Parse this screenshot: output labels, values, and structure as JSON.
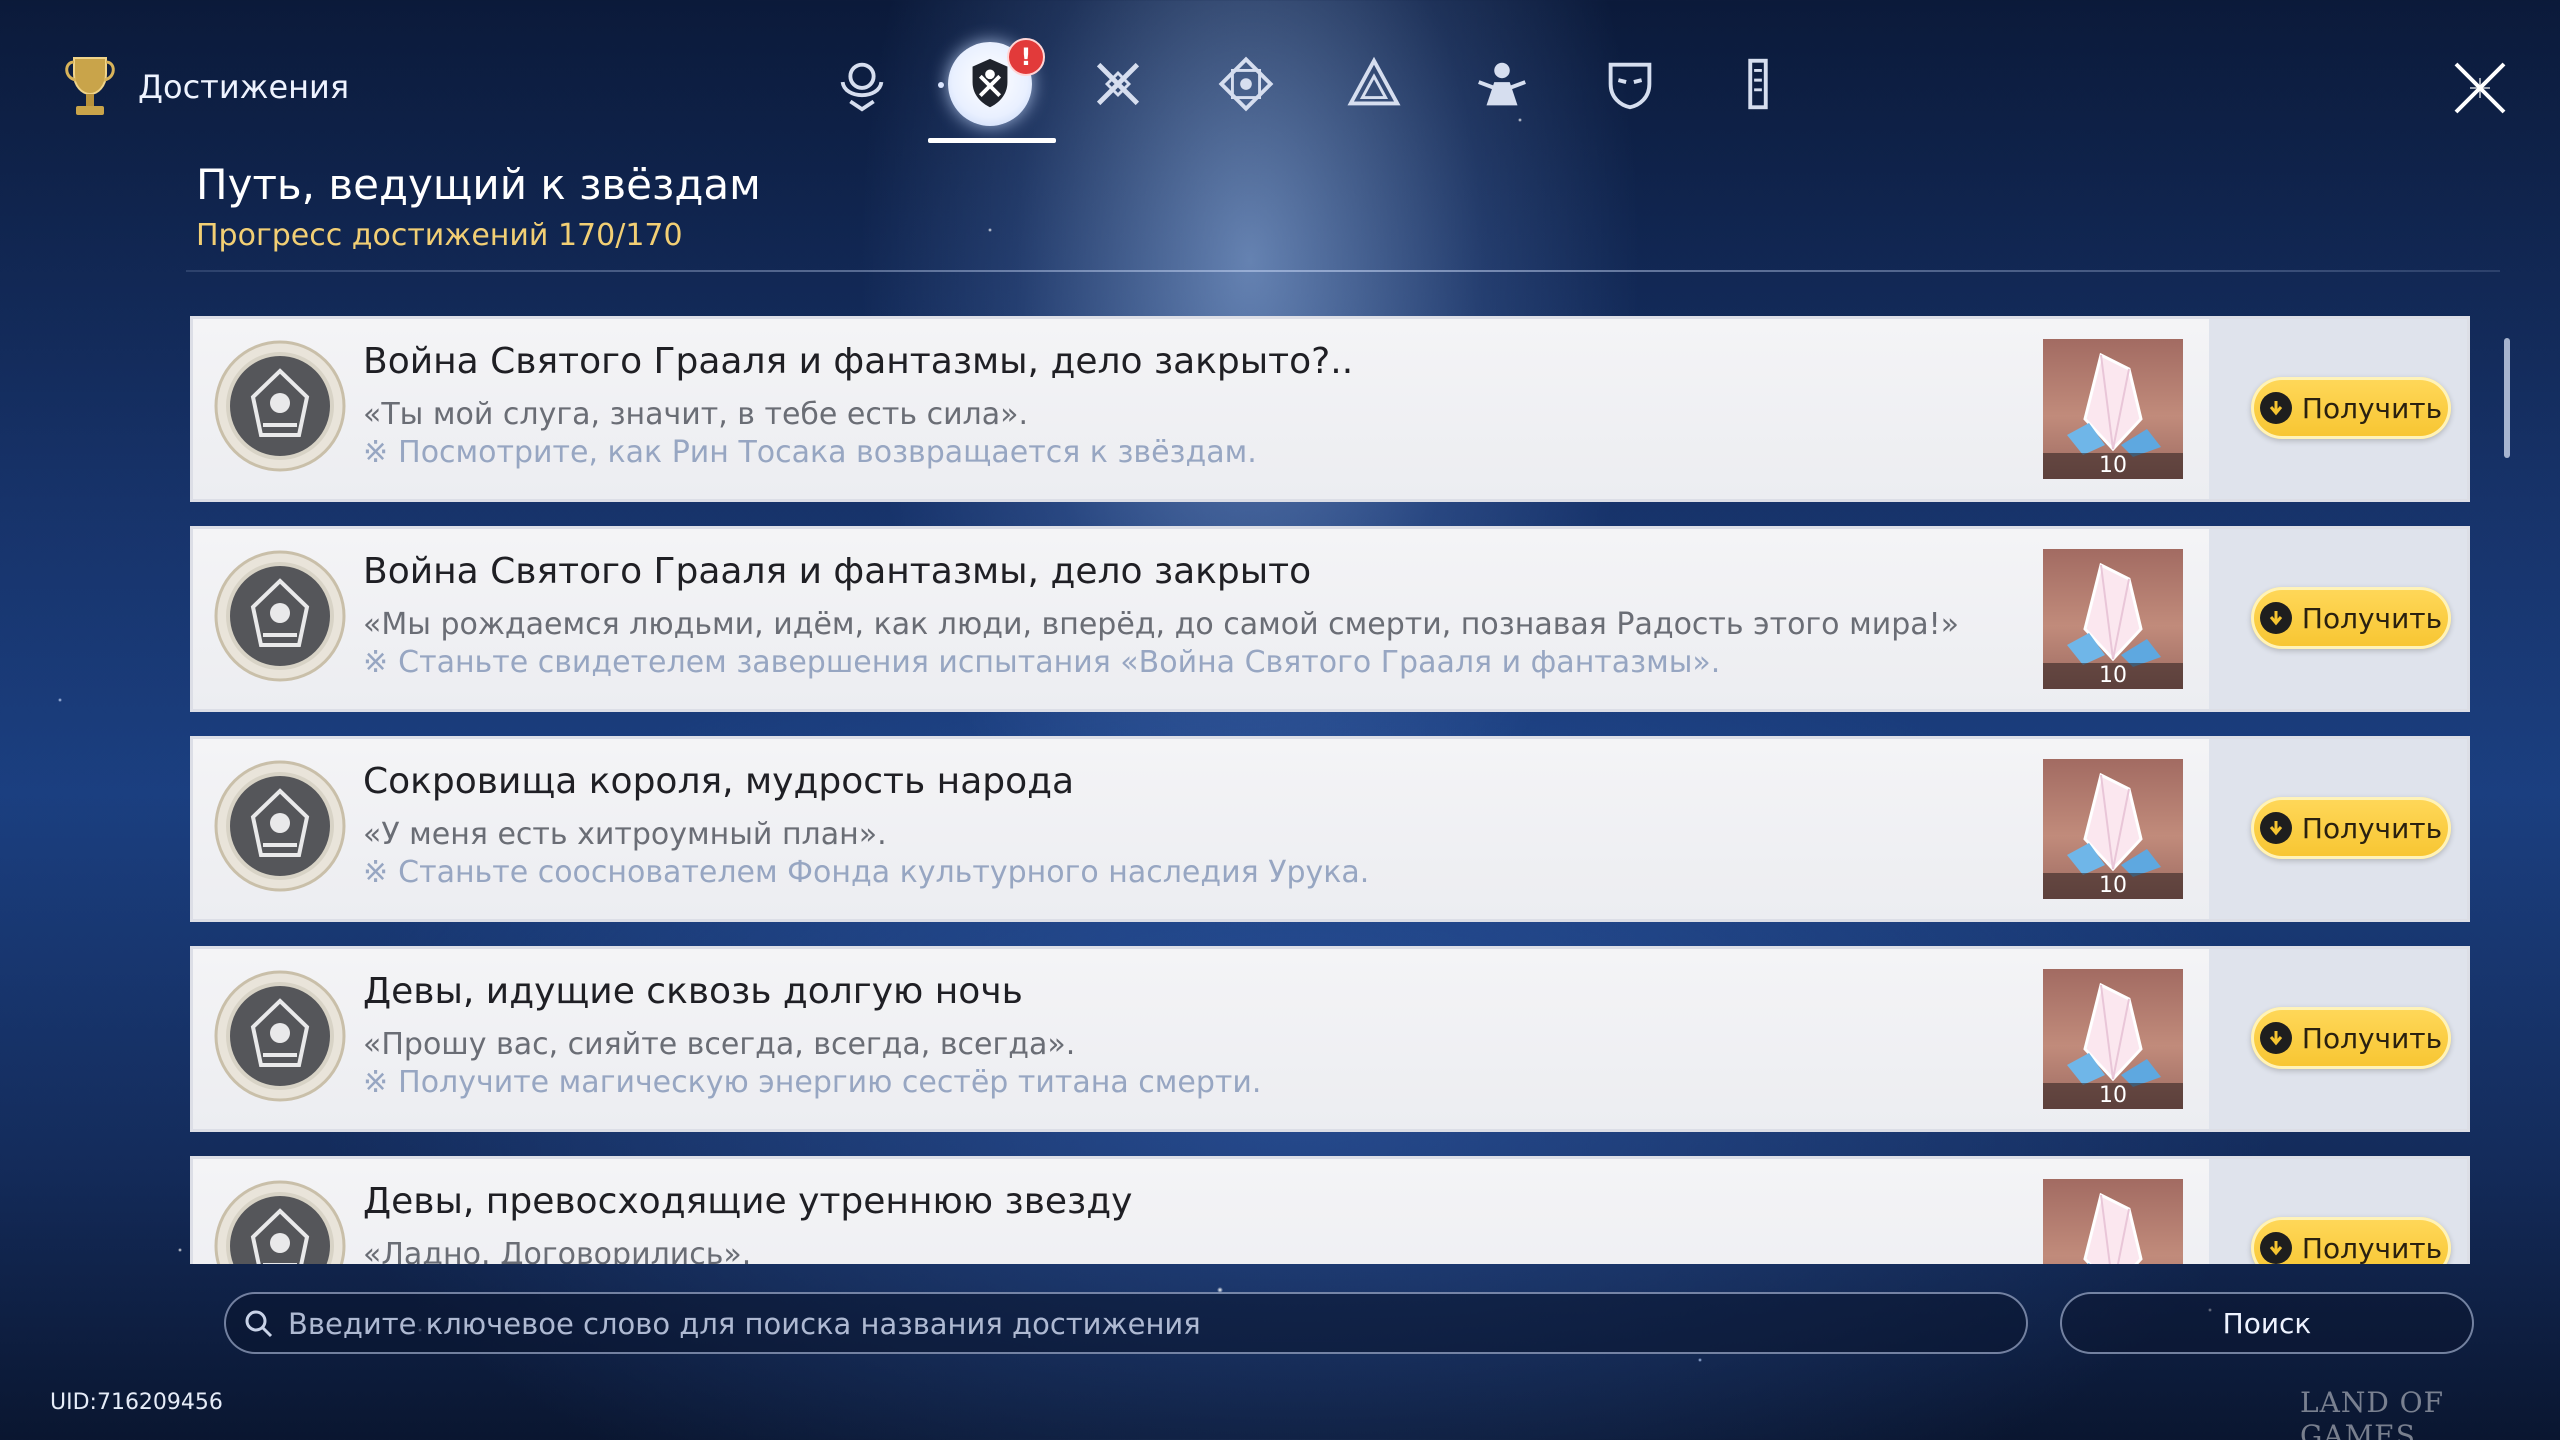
{
  "header": {
    "title": "Достижения",
    "trophy_icon": "trophy-icon",
    "close_icon": "close-icon",
    "tabs": [
      {
        "icon": "wondrous-icon",
        "active": false
      },
      {
        "icon": "sword-shield-icon",
        "active": true,
        "badge": "!"
      },
      {
        "icon": "crossed-swords-icon",
        "active": false
      },
      {
        "icon": "rune-emblem-icon",
        "active": false
      },
      {
        "icon": "triangle-emblem-icon",
        "active": false
      },
      {
        "icon": "mage-icon",
        "active": false
      },
      {
        "icon": "mask-icon",
        "active": false
      },
      {
        "icon": "scroll-icon",
        "active": false
      }
    ]
  },
  "section": {
    "title": "Путь, ведущий к звёздам",
    "progress_label": "Прогресс достижений",
    "progress_value": "170/170"
  },
  "achievements": [
    {
      "title": "Война Святого Грааля и фантазмы, дело закрыто?..",
      "quote": "«Ты мой слуга, значит, в тебе есть сила».",
      "hint_mark": "※",
      "hint": "Посмотрите, как Рин Тосака возвращается к звёздам.",
      "reward_qty": "10",
      "claim_label": "Получить"
    },
    {
      "title": "Война Святого Грааля и фантазмы, дело закрыто",
      "quote": "«Мы рождаемся людьми, идём, как люди, вперёд, до самой смерти, познавая Радость этого мира!»",
      "hint_mark": "※",
      "hint": "Станьте свидетелем завершения испытания «Война Святого Грааля и фантазмы».",
      "reward_qty": "10",
      "claim_label": "Получить"
    },
    {
      "title": "Сокровища короля, мудрость народа",
      "quote": "«У меня есть хитроумный план».",
      "hint_mark": "※",
      "hint": "Станьте сооснователем Фонда культурного наследия Урука.",
      "reward_qty": "10",
      "claim_label": "Получить"
    },
    {
      "title": "Девы, идущие сквозь долгую ночь",
      "quote": "«Прошу вас, сияйте всегда, всегда, всегда».",
      "hint_mark": "※",
      "hint": "Получите магическую энергию сестёр титана смерти.",
      "reward_qty": "10",
      "claim_label": "Получить"
    },
    {
      "title": "Девы, превосходящие утреннюю звезду",
      "quote": "«Ладно. Договорились».",
      "hint_mark": "",
      "hint": "",
      "reward_qty": "",
      "claim_label": "Получить"
    }
  ],
  "search": {
    "placeholder": "Введите ключевое слово для поиска названия достижения",
    "value": "",
    "button_label": "Поиск"
  },
  "footer": {
    "uid": "UID:716209456",
    "watermark": "LAND OF GAMES"
  },
  "colors": {
    "accent_gold": "#f2cf74",
    "claim_button": "#f7c531",
    "alert_red": "#e23a3a",
    "card_bg": "#f4f4f6"
  }
}
